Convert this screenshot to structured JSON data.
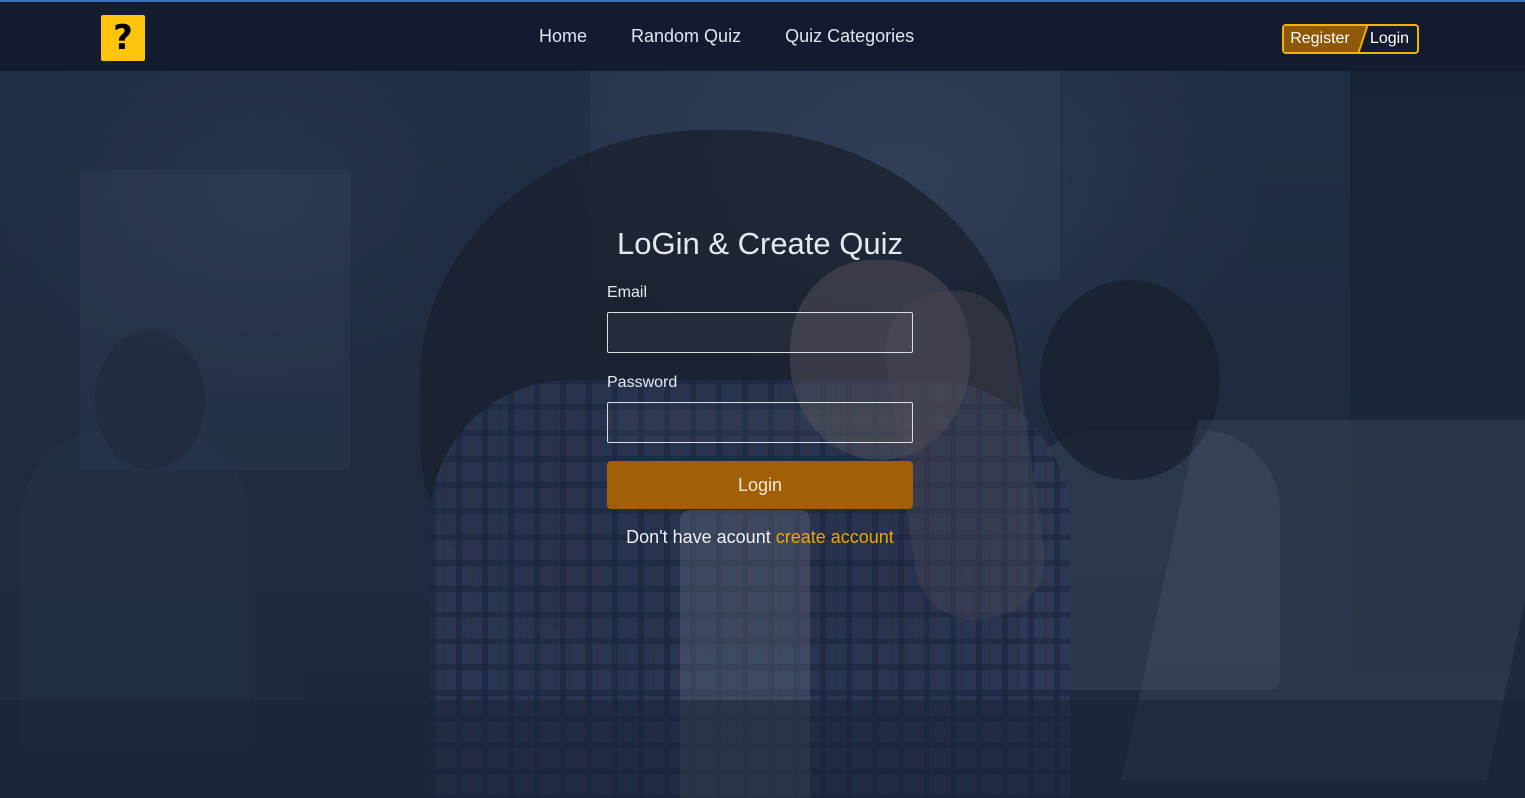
{
  "nav": {
    "logo_glyph": "?",
    "links": [
      {
        "label": "Home"
      },
      {
        "label": "Random Quiz"
      },
      {
        "label": "Quiz Categories"
      }
    ],
    "auth": {
      "register_label": "Register",
      "login_label": "Login"
    }
  },
  "form": {
    "title": "LoGin & Create Quiz",
    "email_label": "Email",
    "email_value": "",
    "password_label": "Password",
    "password_value": "",
    "submit_label": "Login",
    "signup_prompt": "Don't have acount",
    "signup_link": "create account"
  },
  "colors": {
    "accent": "#a05f08",
    "link": "#f0a800",
    "logo": "#ffc40c",
    "navbar": "#121b2c"
  }
}
